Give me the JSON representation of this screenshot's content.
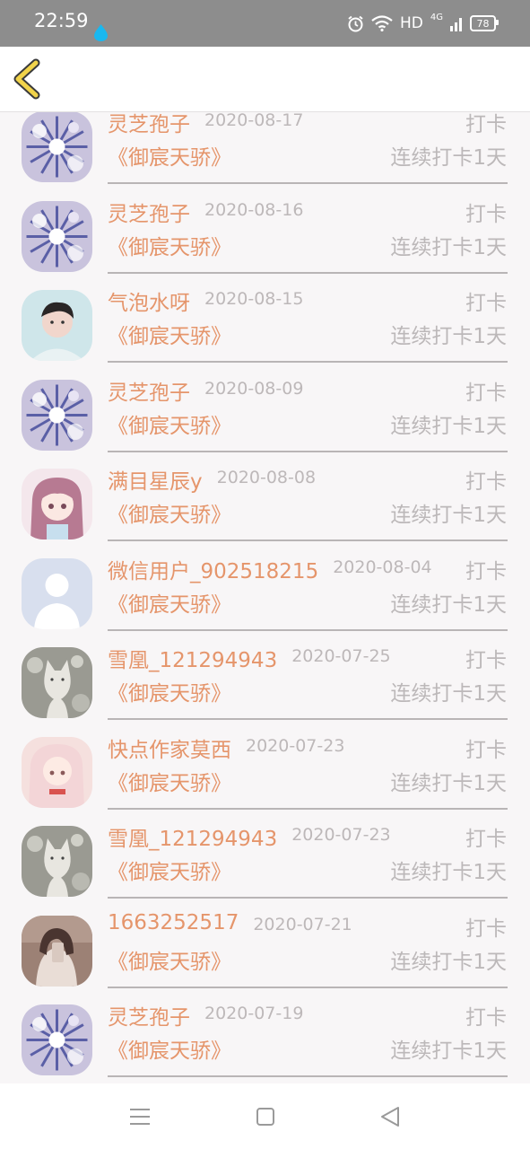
{
  "status_bar": {
    "time": "22:59",
    "network": "HD",
    "network_gen": "4G",
    "battery": "78"
  },
  "header": {
    "back_icon": "chevron-left-icon",
    "accent": "#f1d34a"
  },
  "records": [
    {
      "user": "灵芝孢子",
      "date": "2020-08-17",
      "action": "打卡",
      "book": "《御宸天骄》",
      "streak": "连续打卡1天",
      "avatar": "flower"
    },
    {
      "user": "灵芝孢子",
      "date": "2020-08-16",
      "action": "打卡",
      "book": "《御宸天骄》",
      "streak": "连续打卡1天",
      "avatar": "flower"
    },
    {
      "user": "气泡水呀",
      "date": "2020-08-15",
      "action": "打卡",
      "book": "《御宸天骄》",
      "streak": "连续打卡1天",
      "avatar": "boy"
    },
    {
      "user": "灵芝孢子",
      "date": "2020-08-09",
      "action": "打卡",
      "book": "《御宸天骄》",
      "streak": "连续打卡1天",
      "avatar": "flower"
    },
    {
      "user": "满目星辰y",
      "date": "2020-08-08",
      "action": "打卡",
      "book": "《御宸天骄》",
      "streak": "连续打卡1天",
      "avatar": "anime-girl"
    },
    {
      "user": "微信用户_902518215",
      "date": "2020-08-04",
      "action": "打卡",
      "book": "《御宸天骄》",
      "streak": "连续打卡1天",
      "avatar": "default"
    },
    {
      "user": "雪凰_121294943",
      "date": "2020-07-25",
      "action": "打卡",
      "book": "《御宸天骄》",
      "streak": "连续打卡1天",
      "avatar": "cat"
    },
    {
      "user": "快点作家莫西",
      "date": "2020-07-23",
      "action": "打卡",
      "book": "《御宸天骄》",
      "streak": "连续打卡1天",
      "avatar": "pink-girl"
    },
    {
      "user": "雪凰_121294943",
      "date": "2020-07-23",
      "action": "打卡",
      "book": "《御宸天骄》",
      "streak": "连续打卡1天",
      "avatar": "cat"
    },
    {
      "user": "1663252517",
      "date": "2020-07-21",
      "action": "打卡",
      "book": "《御宸天骄》",
      "streak": "连续打卡1天",
      "avatar": "selfie"
    },
    {
      "user": "灵芝孢子",
      "date": "2020-07-19",
      "action": "打卡",
      "book": "《御宸天骄》",
      "streak": "连续打卡1天",
      "avatar": "flower"
    }
  ],
  "colors": {
    "name": "#e5956b",
    "secondary": "#bcb8b9",
    "divider": "#b9b5b6"
  },
  "nav_bar": {
    "icons": [
      "menu-icon",
      "home-square-icon",
      "back-triangle-icon"
    ]
  }
}
